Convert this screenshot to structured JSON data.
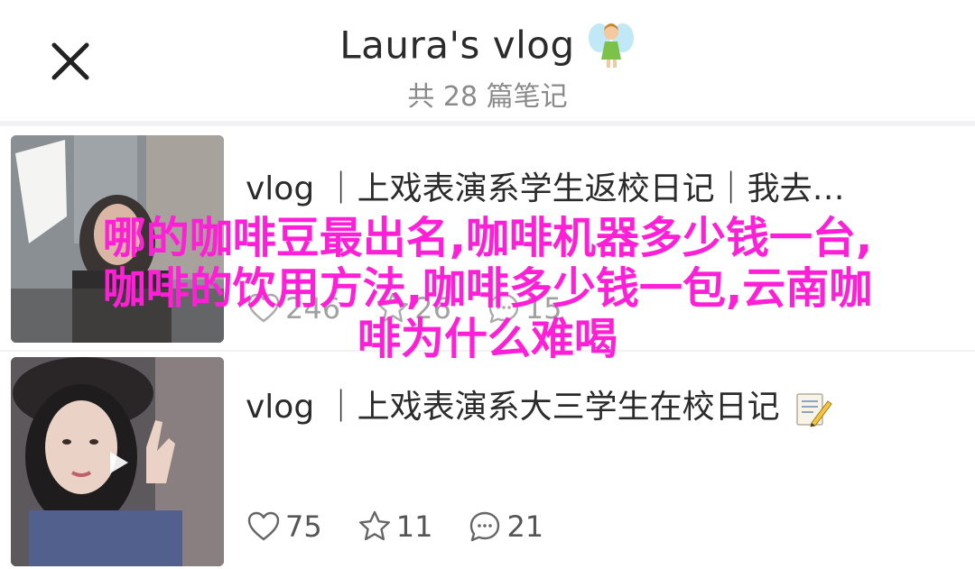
{
  "header": {
    "title": "Laura's vlog",
    "subtitle": "共 28 篇笔记"
  },
  "posts": [
    {
      "title": "vlog ｜上戏表演系学生返校日记｜我去…",
      "likes": "246",
      "stars": "26",
      "comments": "15"
    },
    {
      "title": "vlog ｜上戏表演系大三学生在校日记",
      "likes": "75",
      "stars": "11",
      "comments": "21"
    }
  ],
  "overlay": {
    "line1": "哪的咖啡豆最出名,咖啡机器多少钱一台,",
    "line2": "咖啡的饮用方法,咖啡多少钱一包,云南咖",
    "line3": "啡为什么难喝"
  },
  "colors": {
    "overlay_text": "#ff1fd6",
    "card_bg": "#ffffff",
    "page_bg": "#f2f2f4"
  },
  "icons": [
    "close-icon",
    "fairy-emoji-icon",
    "memo-emoji-icon",
    "heart-icon",
    "star-icon",
    "comment-icon",
    "play-icon"
  ]
}
